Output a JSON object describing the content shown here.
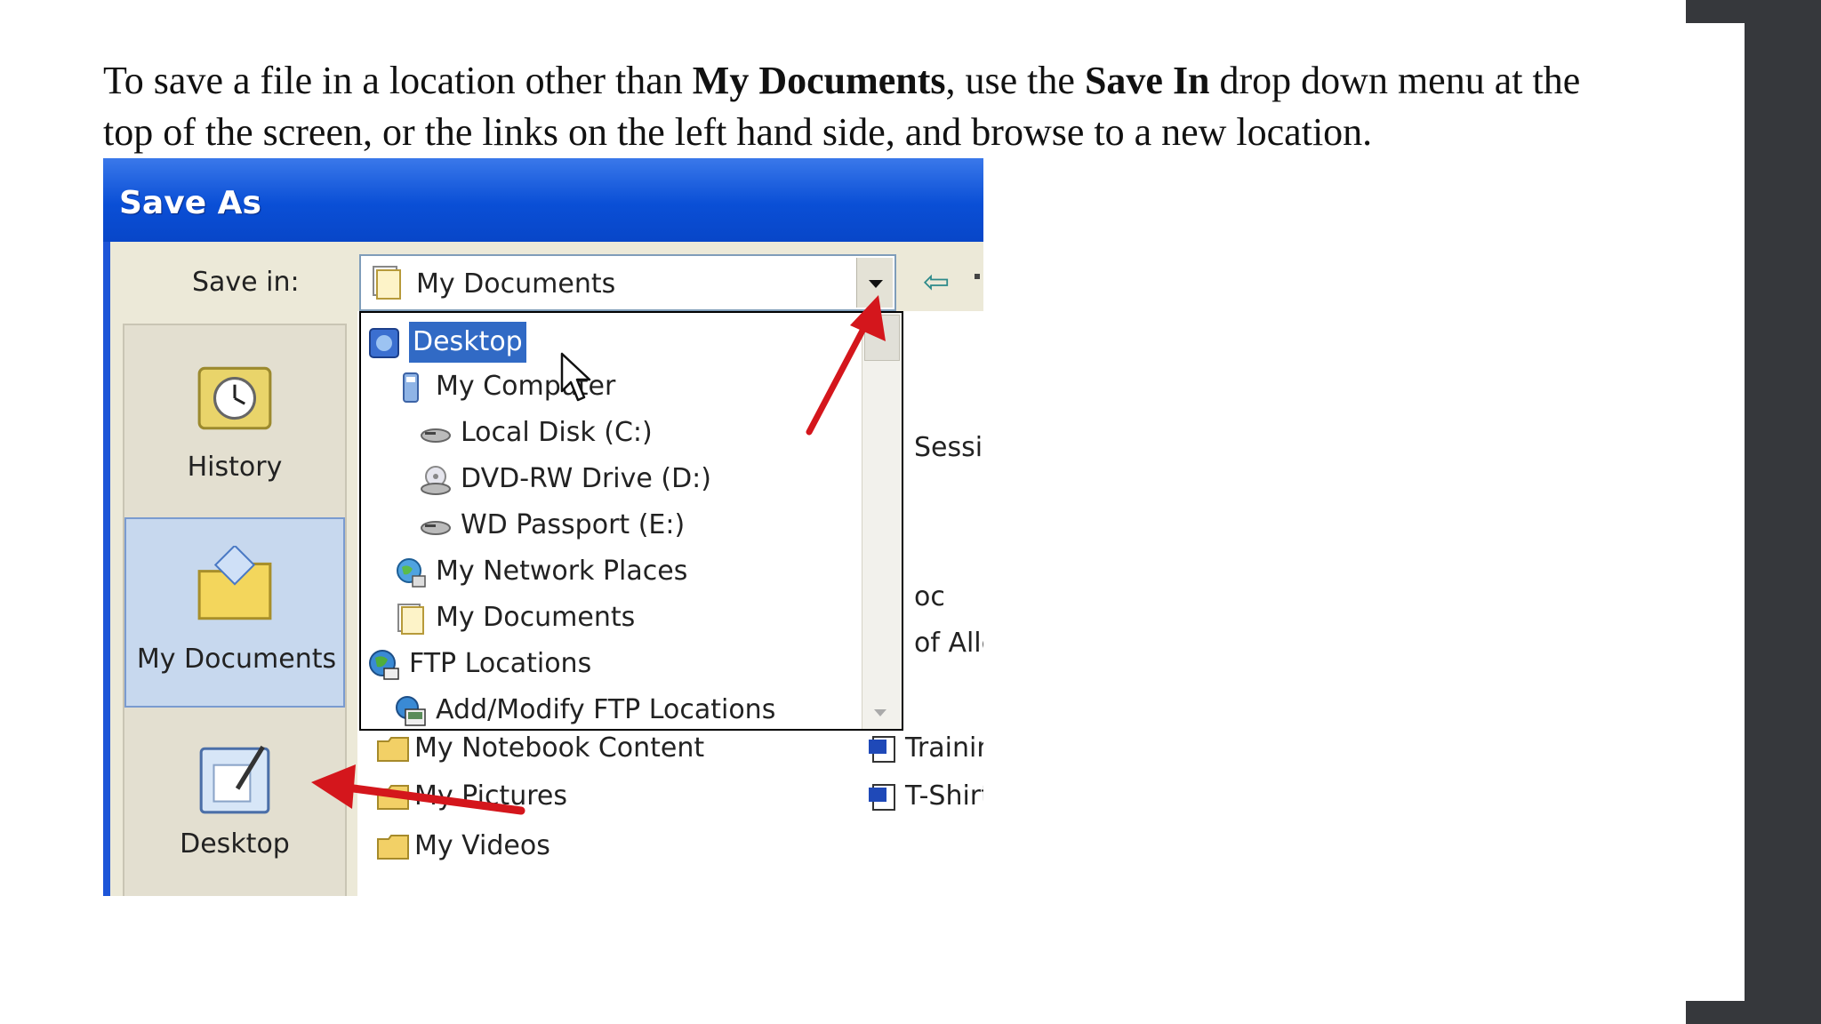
{
  "instruction": {
    "part1": "To save a file in a location other than ",
    "bold1": "My Documents",
    "part2": ", use the ",
    "bold2": "Save In",
    "part3": " drop down menu at the top of the screen, or the links on the left hand side, and browse to a new location."
  },
  "dialog": {
    "title": "Save As",
    "save_in_label": "Save in:",
    "save_in_value": "My Documents"
  },
  "places": [
    {
      "label": "History",
      "icon": "history-icon"
    },
    {
      "label": "My Documents",
      "icon": "my-documents-icon",
      "selected": true
    },
    {
      "label": "Desktop",
      "icon": "desktop-icon"
    }
  ],
  "dropdown_items": [
    {
      "label": "Desktop",
      "icon": "desktop-icon",
      "selected": true
    },
    {
      "label": "My Computer",
      "icon": "my-computer-icon"
    },
    {
      "label": "Local Disk (C:)",
      "icon": "local-disk-icon"
    },
    {
      "label": "DVD-RW Drive (D:)",
      "icon": "dvd-drive-icon"
    },
    {
      "label": "WD Passport (E:)",
      "icon": "drive-icon"
    },
    {
      "label": "My Network Places",
      "icon": "network-places-icon"
    },
    {
      "label": "My Documents",
      "icon": "my-documents-icon"
    },
    {
      "label": "FTP Locations",
      "icon": "ftp-icon"
    },
    {
      "label": "Add/Modify FTP Locations",
      "icon": "ftp-add-icon"
    }
  ],
  "files": [
    {
      "label": "Sessic",
      "icon": ""
    },
    {
      "label": "oc",
      "icon": ""
    },
    {
      "label": "of Alle",
      "icon": ""
    },
    {
      "label": "My Notebook Content",
      "icon": "folder-icon"
    },
    {
      "label": "Training Sign I",
      "icon": "word-doc-icon"
    },
    {
      "label": "My Pictures",
      "icon": "folder-icon"
    },
    {
      "label": "T-Shirt.doc",
      "icon": "word-doc-icon"
    },
    {
      "label": "My Videos",
      "icon": "folder-icon"
    }
  ],
  "colors": {
    "titlebar": "#0a4fd6",
    "selection": "#316ac5",
    "annotation_arrow": "#d4161c"
  }
}
